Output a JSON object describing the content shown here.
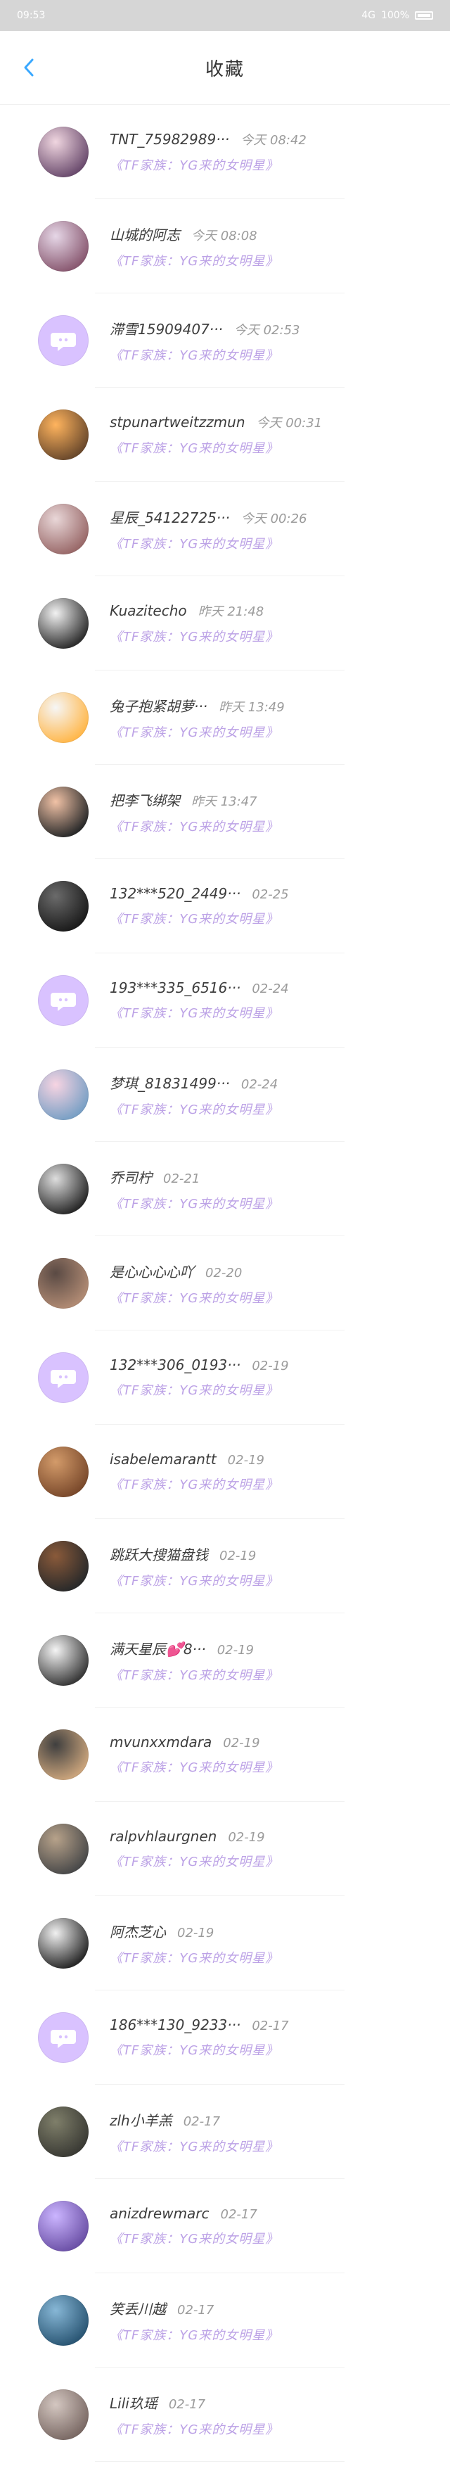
{
  "statusbar": {
    "time": "09:53",
    "signal": "4G",
    "battery": "100%"
  },
  "header": {
    "title": "收藏"
  },
  "items": [
    {
      "name": "TNT_75982989···",
      "time": "今天 08:42",
      "source": "《TF家族：YG来的女明星》",
      "avatar": {
        "type": "photo",
        "colors": [
          "#f0d6e0",
          "#6c4d6f"
        ]
      }
    },
    {
      "name": "山城的阿志",
      "time": "今天 08:08",
      "source": "《TF家族：YG来的女明星》",
      "avatar": {
        "type": "photo",
        "colors": [
          "#e6d7e7",
          "#8a5a72"
        ]
      }
    },
    {
      "name": "滞雪15909407···",
      "time": "今天 02:53",
      "source": "《TF家族：YG来的女明星》",
      "avatar": {
        "type": "msg",
        "colors": [
          "#d9c2ff",
          "#ffffff"
        ]
      }
    },
    {
      "name": "stpunartweitzzmun",
      "time": "今天 00:31",
      "source": "《TF家族：YG来的女明星》",
      "avatar": {
        "type": "photo",
        "colors": [
          "#ffb45e",
          "#6c4a2c"
        ]
      }
    },
    {
      "name": "星辰_54122725···",
      "time": "今天 00:26",
      "source": "《TF家族：YG来的女明星》",
      "avatar": {
        "type": "photo",
        "colors": [
          "#e9d7d8",
          "#9a6a6a"
        ]
      }
    },
    {
      "name": "Kuazitecho",
      "time": "昨天 21:48",
      "source": "《TF家族：YG来的女明星》",
      "avatar": {
        "type": "photo",
        "colors": [
          "#f2f2f2",
          "#2f2f2f"
        ]
      }
    },
    {
      "name": "兔子抱紧胡萝···",
      "time": "昨天 13:49",
      "source": "《TF家族：YG来的女明星》",
      "avatar": {
        "type": "photo",
        "colors": [
          "#f6f6f6",
          "#ffb84d"
        ]
      }
    },
    {
      "name": "把李飞绑架",
      "time": "昨天 13:47",
      "source": "《TF家族：YG来的女明星》",
      "avatar": {
        "type": "photo",
        "colors": [
          "#f1c2a6",
          "#2b2b2b"
        ]
      }
    },
    {
      "name": "132***520_2449···",
      "time": "02-25",
      "source": "《TF家族：YG来的女明星》",
      "avatar": {
        "type": "photo",
        "colors": [
          "#6b6b6b",
          "#1c1c1c"
        ]
      }
    },
    {
      "name": "193***335_6516···",
      "time": "02-24",
      "source": "《TF家族：YG来的女明星》",
      "avatar": {
        "type": "msg",
        "colors": [
          "#d9c2ff",
          "#ffffff"
        ]
      }
    },
    {
      "name": "梦琪_81831499···",
      "time": "02-24",
      "source": "《TF家族：YG来的女明星》",
      "avatar": {
        "type": "photo",
        "colors": [
          "#f7d4e2",
          "#7aa0c5"
        ]
      }
    },
    {
      "name": "乔司柠",
      "time": "02-21",
      "source": "《TF家族：YG来的女明星》",
      "avatar": {
        "type": "photo",
        "colors": [
          "#dedede",
          "#2a2a2a"
        ]
      }
    },
    {
      "name": "是心心心心吖",
      "time": "02-20",
      "source": "《TF家族：YG来的女明星》",
      "avatar": {
        "type": "photo",
        "colors": [
          "#5a4a44",
          "#b08a73"
        ]
      }
    },
    {
      "name": "132***306_0193···",
      "time": "02-19",
      "source": "《TF家族：YG来的女明星》",
      "avatar": {
        "type": "msg",
        "colors": [
          "#d9c2ff",
          "#ffffff"
        ]
      }
    },
    {
      "name": "isabelemarantt",
      "time": "02-19",
      "source": "《TF家族：YG来的女明星》",
      "avatar": {
        "type": "photo",
        "colors": [
          "#d39b6a",
          "#7b4a2c"
        ]
      }
    },
    {
      "name": "跳跃大搜猫盘钱",
      "time": "02-19",
      "source": "《TF家族：YG来的女明星》",
      "avatar": {
        "type": "photo",
        "colors": [
          "#8a5a3a",
          "#2a2a2a"
        ]
      }
    },
    {
      "name": "满天星辰💕8···",
      "time": "02-19",
      "source": "《TF家族：YG来的女明星》",
      "avatar": {
        "type": "photo",
        "colors": [
          "#f5f5f5",
          "#3a3a3a"
        ]
      }
    },
    {
      "name": "mvunxxmdara",
      "time": "02-19",
      "source": "《TF家族：YG来的女明星》",
      "avatar": {
        "type": "photo",
        "colors": [
          "#3f3f3f",
          "#c9a37b"
        ]
      }
    },
    {
      "name": "ralpvhlaurgnen",
      "time": "02-19",
      "source": "《TF家族：YG来的女明星》",
      "avatar": {
        "type": "photo",
        "colors": [
          "#b7a28a",
          "#4a4a4a"
        ]
      }
    },
    {
      "name": "阿杰芝心",
      "time": "02-19",
      "source": "《TF家族：YG来的女明星》",
      "avatar": {
        "type": "photo",
        "colors": [
          "#f1f1f1",
          "#2a2a2a"
        ]
      }
    },
    {
      "name": "186***130_9233···",
      "time": "02-17",
      "source": "《TF家族：YG来的女明星》",
      "avatar": {
        "type": "msg",
        "colors": [
          "#d9c2ff",
          "#ffffff"
        ]
      }
    },
    {
      "name": "zlh小羊羔",
      "time": "02-17",
      "source": "《TF家族：YG来的女明星》",
      "avatar": {
        "type": "photo",
        "colors": [
          "#7f7f6a",
          "#3b3b35"
        ]
      }
    },
    {
      "name": "anizdrewmarc",
      "time": "02-17",
      "source": "《TF家族：YG来的女明星》",
      "avatar": {
        "type": "photo",
        "colors": [
          "#cbb5ff",
          "#6d52a8"
        ]
      }
    },
    {
      "name": "笑丢川越",
      "time": "02-17",
      "source": "《TF家族：YG来的女明星》",
      "avatar": {
        "type": "photo",
        "colors": [
          "#87b7d6",
          "#2b5775"
        ]
      }
    },
    {
      "name": "Lili玖瑶",
      "time": "02-17",
      "source": "《TF家族：YG来的女明星》",
      "avatar": {
        "type": "photo",
        "colors": [
          "#d4c7c1",
          "#7b6a65"
        ]
      }
    }
  ]
}
